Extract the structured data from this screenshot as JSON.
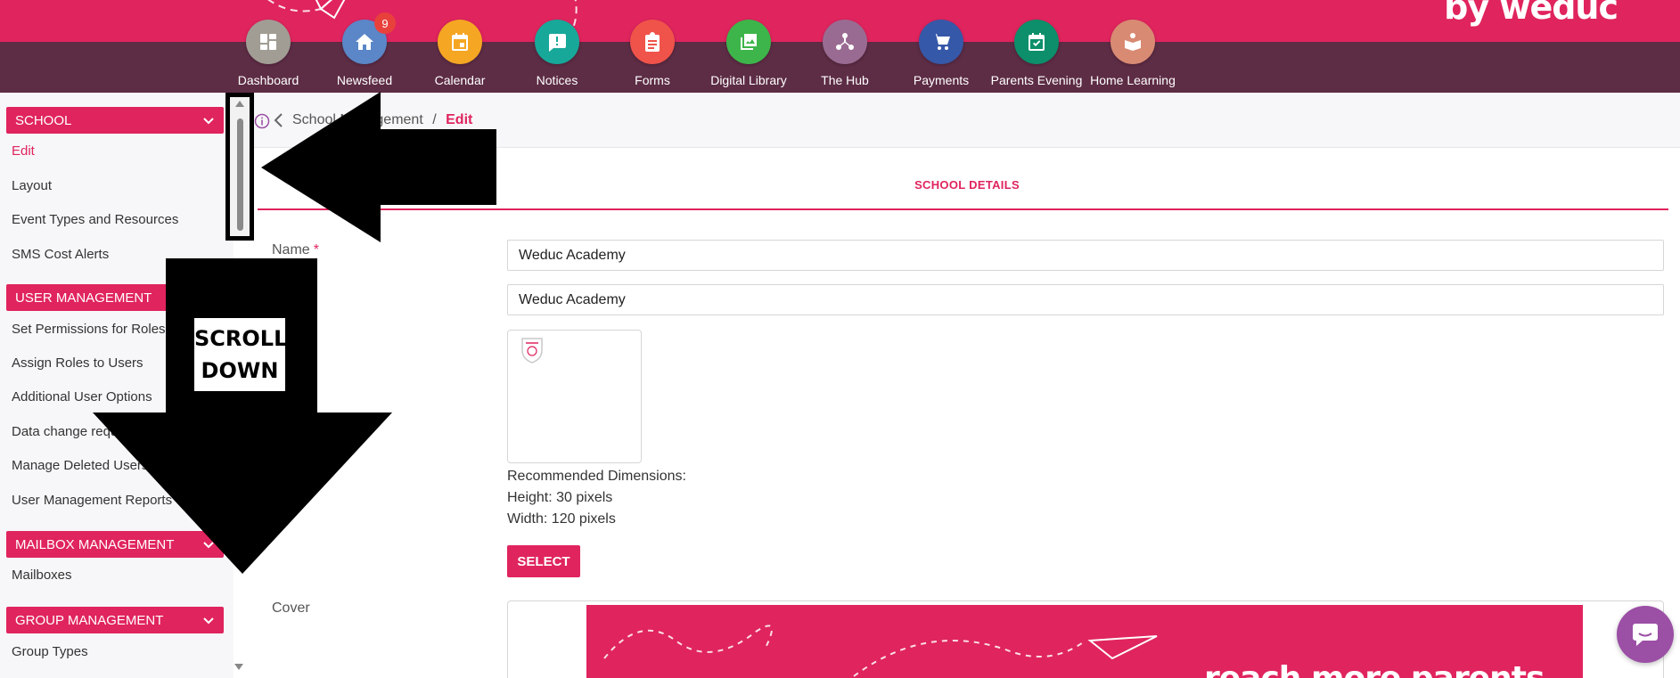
{
  "brand": {
    "text": "by weduc"
  },
  "nav": [
    {
      "label": "Dashboard",
      "icon": "dashboard-icon",
      "color": "#a19d94"
    },
    {
      "label": "Newsfeed",
      "icon": "home-icon",
      "color": "#5b86c7",
      "badge": "9"
    },
    {
      "label": "Calendar",
      "icon": "calendar-icon",
      "color": "#f5a623"
    },
    {
      "label": "Notices",
      "icon": "notice-icon",
      "color": "#17a89a"
    },
    {
      "label": "Forms",
      "icon": "clipboard-icon",
      "color": "#f0534a"
    },
    {
      "label": "Digital Library",
      "icon": "image-icon",
      "color": "#3db54a"
    },
    {
      "label": "The Hub",
      "icon": "hub-icon",
      "color": "#9a6b92"
    },
    {
      "label": "Payments",
      "icon": "cart-icon",
      "color": "#3658a8"
    },
    {
      "label": "Parents Evening",
      "icon": "calendar-check-icon",
      "color": "#0c8f6a"
    },
    {
      "label": "Home Learning",
      "icon": "book-reader-icon",
      "color": "#d98a73"
    }
  ],
  "sidebar": {
    "school": {
      "title": "SCHOOL",
      "items": [
        "Edit",
        "Layout",
        "Event Types and Resources",
        "SMS Cost Alerts"
      ]
    },
    "user_management": {
      "title": "USER MANAGEMENT",
      "items": [
        "Set Permissions for Roles",
        "Assign Roles to Users",
        "Additional User Options",
        "Data change requests",
        "Manage Deleted Users",
        "User Management Reports"
      ]
    },
    "mailbox_management": {
      "title": "MAILBOX MANAGEMENT",
      "items": [
        "Mailboxes"
      ]
    },
    "group_management": {
      "title": "GROUP MANAGEMENT",
      "items": [
        "Group Types"
      ]
    }
  },
  "breadcrumb": {
    "parent": "School Management",
    "separator": "/",
    "current": "Edit"
  },
  "tab": {
    "title": "SCHOOL DETAILS"
  },
  "form": {
    "name_label": "Name",
    "required_mark": "*",
    "name_value": "Weduc Academy",
    "short_name_value": "Weduc Academy",
    "dims_heading": "Recommended Dimensions:",
    "dims_height": "Height: 30 pixels",
    "dims_width": "Width: 120 pixels",
    "select_label": "SELECT",
    "cover_label": "Cover",
    "cover_text": "reach more parents"
  },
  "overlay": {
    "scroll_line1": "SCROLL",
    "scroll_line2": "DOWN"
  },
  "colors": {
    "accent": "#e0245e",
    "navbar": "#5d2c45",
    "chat": "#9b4fa5"
  }
}
